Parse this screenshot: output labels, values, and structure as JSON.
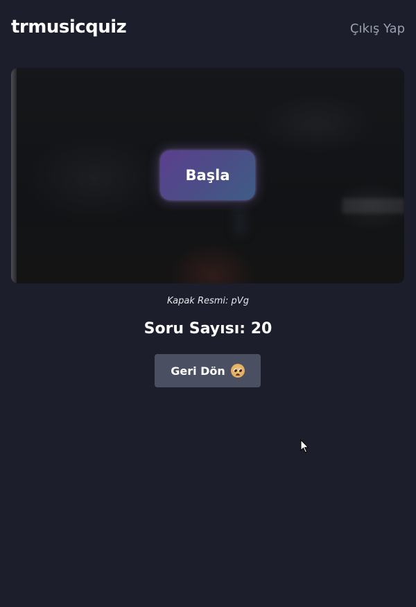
{
  "header": {
    "brand": "trmusicquiz",
    "logout_label": "Çıkış Yap"
  },
  "hero": {
    "start_label": "Başla"
  },
  "caption": "Kapak Resmi: pVg",
  "question_count": "Soru Sayısı: 20",
  "back_button": {
    "label": "Geri Dön",
    "icon": "pleading-face-icon"
  },
  "colors": {
    "background": "#1c1f2b",
    "start_gradient_from": "#5b3f8f",
    "start_gradient_to": "#3f5d86",
    "back_button": "#4a5061",
    "logout_text": "#9aa0b0"
  }
}
